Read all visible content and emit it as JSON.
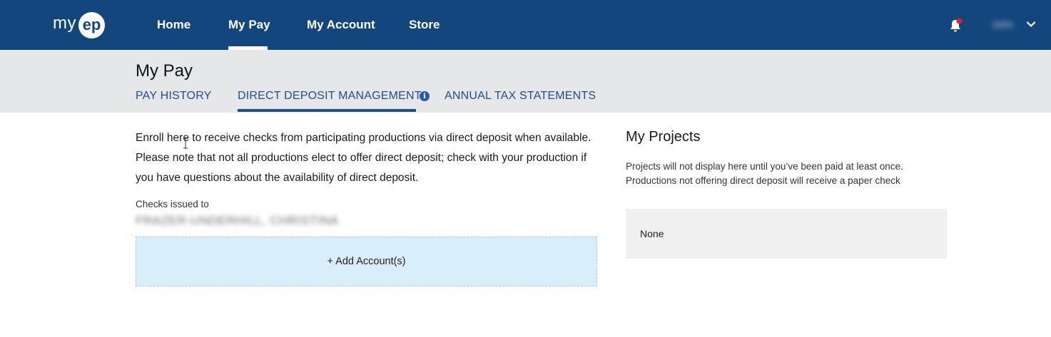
{
  "brand": {
    "logo_text": "my",
    "logo_badge": "ep",
    "primary_color": "#13467c",
    "notification_color": "#e0202a"
  },
  "nav": {
    "home": "Home",
    "my_pay": "My Pay",
    "my_account": "My Account",
    "store": "Store",
    "active": "My Pay",
    "user_name": "John"
  },
  "header": {
    "title": "My Pay",
    "tabs": [
      {
        "label": "PAY HISTORY"
      },
      {
        "label": "DIRECT DEPOSIT MANAGEMENT",
        "active": true
      },
      {
        "label": "ANNUAL TAX STATEMENTS"
      }
    ],
    "info_glyph": "i"
  },
  "main": {
    "intro": "Enroll here to receive checks from participating productions via direct deposit when available. Please note that not all productions elect to offer direct deposit; check with your production if you have questions about the availability of direct deposit.",
    "checks_label": "Checks issued to",
    "checks_name": "FRAZER-UNDERHILL, CHRISTINA",
    "add_account": "+ Add Account(s)"
  },
  "projects": {
    "title": "My Projects",
    "note": "Projects will not display here until you’ve been paid at least once. Productions not offering direct deposit will receive a paper check",
    "empty": "None"
  },
  "icons": [
    "bell-icon",
    "chevron-down-icon",
    "info-icon",
    "text-cursor-icon"
  ]
}
